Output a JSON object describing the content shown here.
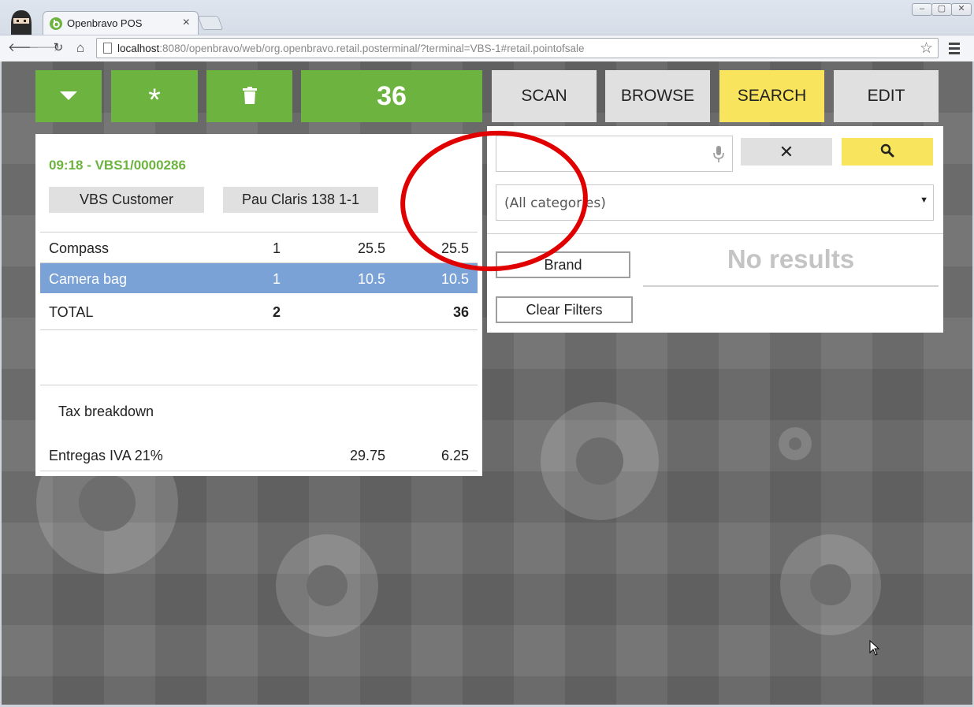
{
  "browser": {
    "tab_title": "Openbravo POS",
    "tab_close": "×",
    "url_host": "localhost",
    "url_path": ":8080/openbravo/web/org.openbravo.retail.posterminal/?terminal=VBS-1#retail.pointofsale",
    "win_minimize": "–",
    "win_maximize": "▢",
    "win_close": "✕",
    "back_icon": "🡐",
    "forward_icon": "🡒",
    "reload_icon": "↻",
    "home_icon": "⌂",
    "star_icon": "☆"
  },
  "toolbar": {
    "menu_icon": "menu-down-triangle",
    "new_order_label": "*",
    "delete_icon": "trash-icon",
    "total": "36",
    "tabs": [
      {
        "label": "SCAN"
      },
      {
        "label": "BROWSE"
      },
      {
        "label": "SEARCH",
        "active": true
      },
      {
        "label": "EDIT"
      }
    ]
  },
  "receipt": {
    "ticket_id": "09:18 - VBS1/0000286",
    "customer": "VBS Customer",
    "address": "Pau Claris 138 1-1",
    "lines": [
      {
        "product": "Compass",
        "qty": "1",
        "price": "25.5",
        "gross": "25.5",
        "selected": false
      },
      {
        "product": "Camera bag",
        "qty": "1",
        "price": "10.5",
        "gross": "10.5",
        "selected": true
      }
    ],
    "total": {
      "label": "TOTAL",
      "qty": "2",
      "amount": "36"
    },
    "tax_title": "Tax breakdown",
    "taxes": [
      {
        "name": "Entregas IVA 21%",
        "net": "29.75",
        "amount": "6.25"
      }
    ]
  },
  "search": {
    "query": "",
    "placeholder": "",
    "clear_label": "✕",
    "category": "(All categories)",
    "brand_label": "Brand",
    "clear_filters_label": "Clear Filters",
    "no_results": "No results"
  },
  "colors": {
    "green": "#6db33f",
    "yellow": "#f8e55d",
    "selected_row": "#7ba2d6",
    "annotation": "#e00000"
  }
}
